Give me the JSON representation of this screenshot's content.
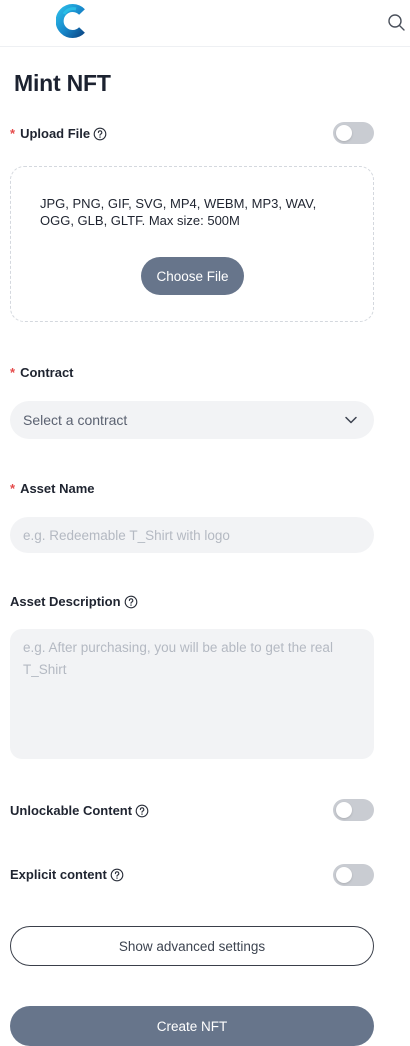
{
  "header": {
    "logo_icon": "brand-c-logo",
    "search_icon": "search-icon"
  },
  "page": {
    "title": "Mint NFT"
  },
  "upload": {
    "required_mark": "*",
    "label": "Upload File",
    "toggle_on": false,
    "formats_text": "JPG, PNG, GIF, SVG, MP4, WEBM, MP3, WAV, OGG, GLB, GLTF. Max size: 500M",
    "choose_label": "Choose File"
  },
  "contract": {
    "required_mark": "*",
    "label": "Contract",
    "selected": "Select a contract"
  },
  "asset_name": {
    "required_mark": "*",
    "label": "Asset Name",
    "placeholder": "e.g. Redeemable T_Shirt with logo",
    "value": ""
  },
  "asset_description": {
    "label": "Asset Description",
    "placeholder": "e.g. After purchasing, you will be able to get the real T_Shirt",
    "value": ""
  },
  "unlockable": {
    "label": "Unlockable Content",
    "toggle_on": false
  },
  "explicit": {
    "label": "Explicit content",
    "toggle_on": false
  },
  "actions": {
    "advanced_label": "Show advanced settings",
    "create_label": "Create NFT"
  },
  "colors": {
    "primary_button": "#67758b",
    "required": "#e54b4b",
    "field_bg": "#f2f3f5",
    "toggle_off": "#c9ccd2"
  }
}
